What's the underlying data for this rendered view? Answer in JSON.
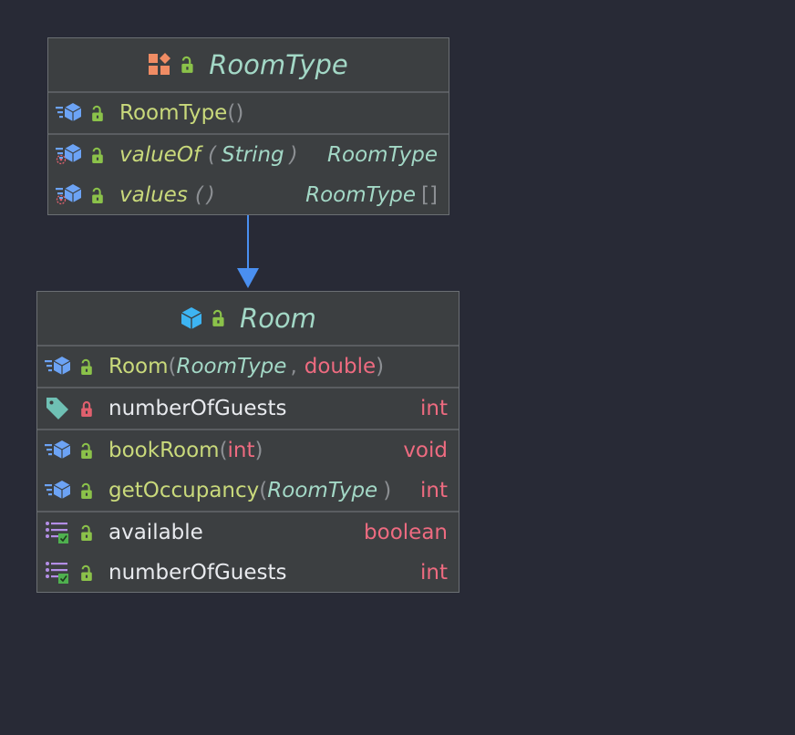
{
  "classes": {
    "roomtype": {
      "name": "RoomType",
      "constructor": {
        "name": "RoomType",
        "open": "(",
        "close": ")"
      },
      "methods": [
        {
          "name": "valueOf",
          "open": "(",
          "param": "String",
          "close": ")",
          "returns": "RoomType"
        },
        {
          "name": "values",
          "open": "(",
          "close": ")",
          "returns": "RoomType",
          "suffix": "[]"
        }
      ]
    },
    "room": {
      "name": "Room",
      "constructor": {
        "name": "Room",
        "open": "(",
        "param1": "RoomType",
        "comma": ",",
        "param2": "double",
        "close": ")"
      },
      "fields": [
        {
          "name": "numberOfGuests",
          "type": "int"
        }
      ],
      "methods": [
        {
          "name": "bookRoom",
          "open": "(",
          "param": "int",
          "close": ")",
          "returns": "void"
        },
        {
          "name": "getOccupancy",
          "open": "(",
          "param": "RoomType",
          "close": ")",
          "returns": "int"
        }
      ],
      "properties": [
        {
          "name": "available",
          "type": "boolean"
        },
        {
          "name": "numberOfGuests",
          "type": "int"
        }
      ]
    }
  },
  "colors": {
    "background": "#282a36",
    "box": "#3c3f41",
    "arrow": "#4a8ff0",
    "method": "#c9d97b",
    "type": "#a3d8c6",
    "primitive": "#ee6b80"
  },
  "icons": {
    "enum": "enum-icon",
    "class": "class-icon",
    "method": "method-icon",
    "static-method": "static-method-icon",
    "field": "field-tag-icon",
    "property": "property-icon",
    "public": "unlocked-icon",
    "private": "locked-icon"
  }
}
